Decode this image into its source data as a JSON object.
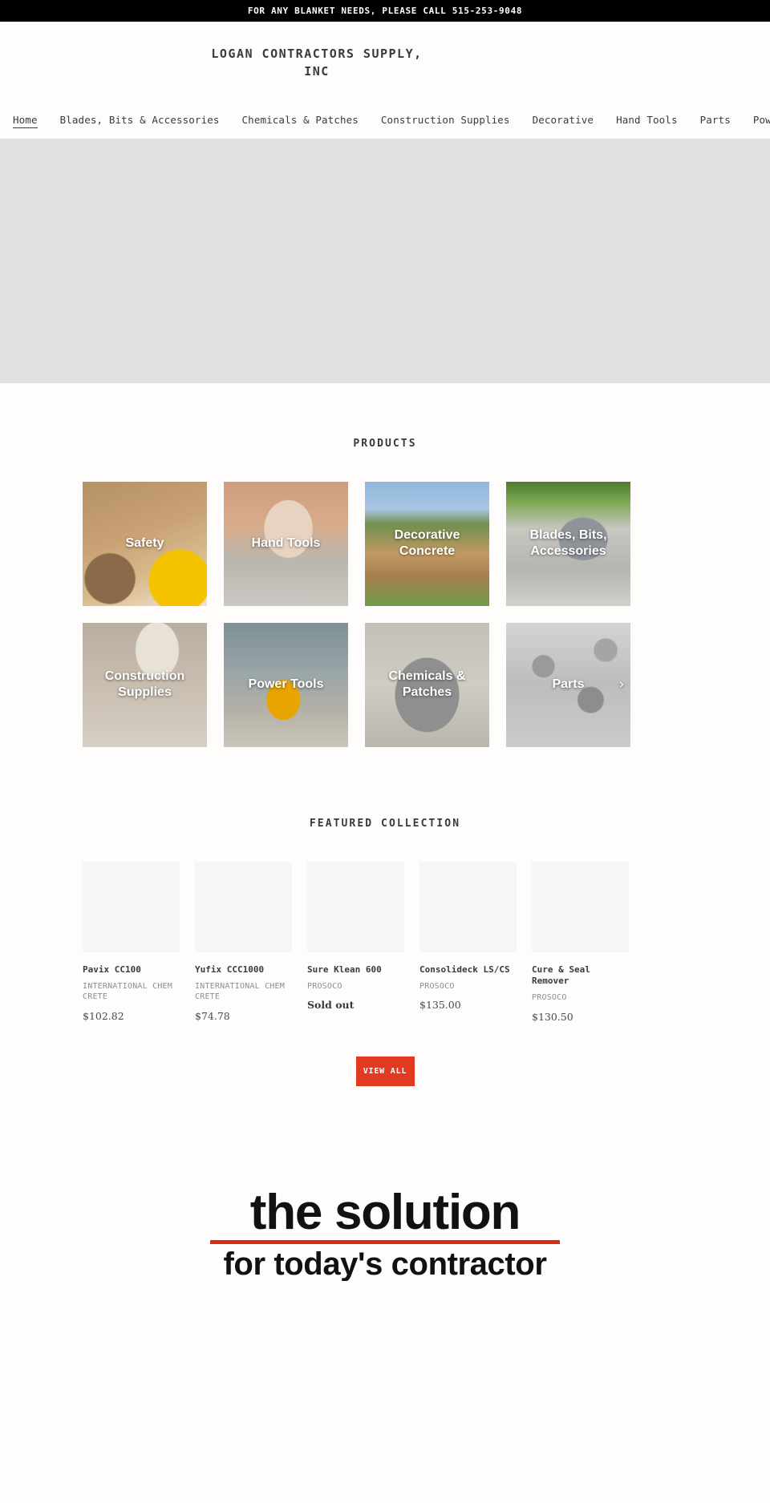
{
  "announcement": {
    "text": "FOR ANY BLANKET NEEDS, PLEASE CALL 515-253-9048"
  },
  "header": {
    "brand_line1": "LOGAN CONTRACTORS SUPPLY,",
    "brand_line2": "INC"
  },
  "nav": {
    "items": [
      {
        "label": "Home",
        "active": true
      },
      {
        "label": "Blades, Bits & Accessories",
        "active": false
      },
      {
        "label": "Chemicals & Patches",
        "active": false
      },
      {
        "label": "Construction Supplies",
        "active": false
      },
      {
        "label": "Decorative",
        "active": false
      },
      {
        "label": "Hand Tools",
        "active": false
      },
      {
        "label": "Parts",
        "active": false
      },
      {
        "label": "Power Tools",
        "active": false
      }
    ]
  },
  "products_section": {
    "title": "PRODUCTS",
    "tiles": [
      {
        "label": "Safety",
        "art": "art-safety",
        "arrow": ""
      },
      {
        "label": "Hand Tools",
        "art": "art-hand",
        "arrow": ""
      },
      {
        "label": "Decorative Concrete",
        "art": "art-deco",
        "arrow": ""
      },
      {
        "label": "Blades, Bits, Accessories",
        "art": "art-blades",
        "arrow": ""
      },
      {
        "label": "Construction Supplies",
        "art": "art-constr",
        "arrow": ""
      },
      {
        "label": "Power Tools",
        "art": "art-power",
        "arrow": ""
      },
      {
        "label": "Chemicals & Patches",
        "art": "art-chem",
        "arrow": ""
      },
      {
        "label": "Parts",
        "art": "art-parts",
        "arrow": "›"
      }
    ]
  },
  "featured_section": {
    "title": "FEATURED COLLECTION",
    "products": [
      {
        "title": "Pavix CC100",
        "vendor": "INTERNATIONAL CHEM CRETE",
        "price": "$102.82",
        "sold_out": false
      },
      {
        "title": "Yufix CCC1000",
        "vendor": "INTERNATIONAL CHEM CRETE",
        "price": "$74.78",
        "sold_out": false
      },
      {
        "title": "Sure Klean 600",
        "vendor": "PROSOCO",
        "price": "Sold out",
        "sold_out": true
      },
      {
        "title": "Consolideck LS/CS",
        "vendor": "PROSOCO",
        "price": "$135.00",
        "sold_out": false
      },
      {
        "title": "Cure & Seal Remover",
        "vendor": "PROSOCO",
        "price": "$130.50",
        "sold_out": false
      }
    ],
    "view_all_label": "VIEW ALL"
  },
  "bottom_banner": {
    "line1": "the solution",
    "line2": "for today's contractor"
  },
  "colors": {
    "accent_red": "#e03a22",
    "banner_rule_red": "#d92b16",
    "announcement_bg": "#000000",
    "page_bg": "#fffdfb",
    "hero_bg": "#e0e0e0"
  }
}
